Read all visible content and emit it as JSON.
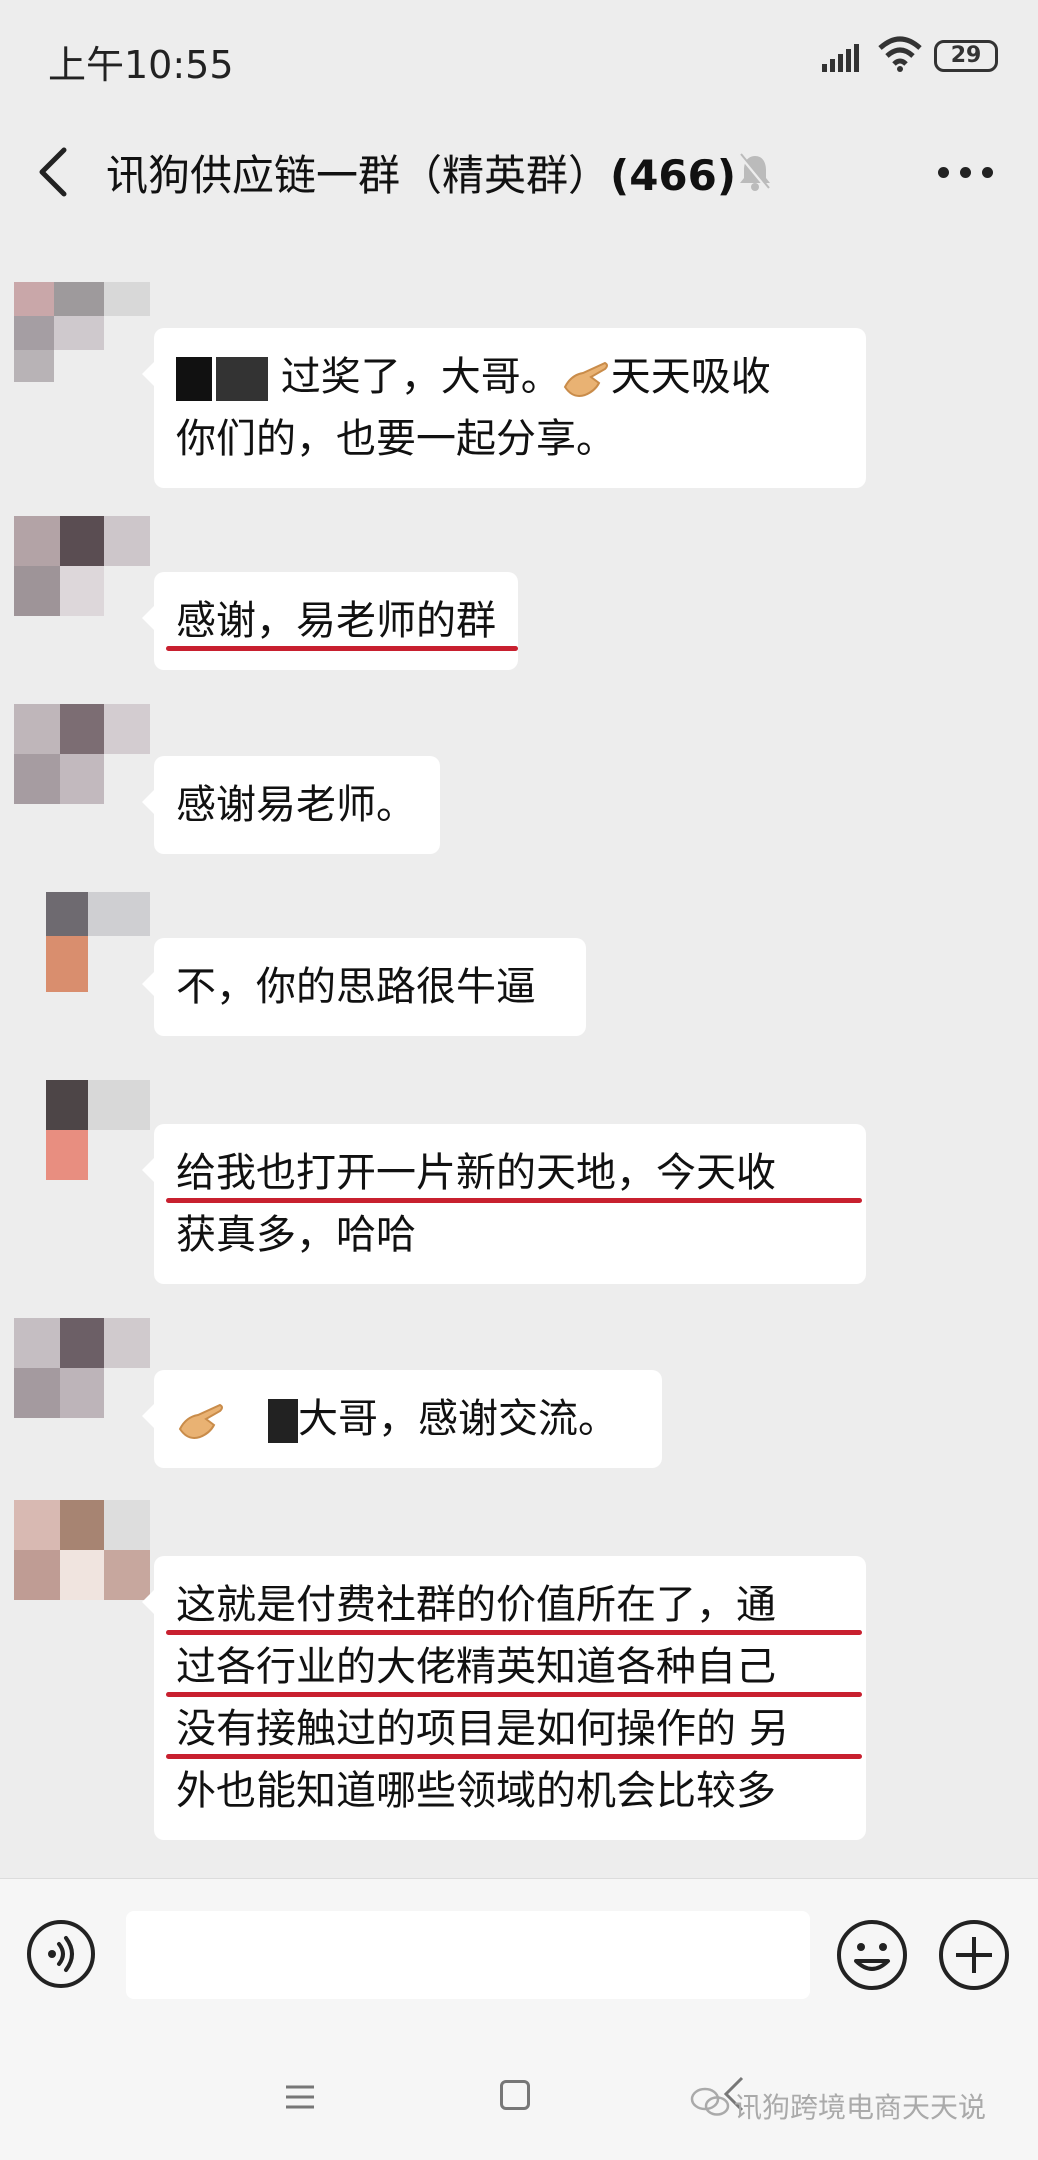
{
  "status_bar": {
    "time": "上午10:55",
    "battery": "29"
  },
  "header": {
    "title": "讯狗供应链一群（精英群）",
    "member_count": "(466)"
  },
  "messages": [
    {
      "lines": [
        "过奖了，大哥。",
        "天天吸收",
        "你们的，也要一起分享。"
      ]
    },
    {
      "lines": [
        "感谢，易老师的群"
      ]
    },
    {
      "lines": [
        "感谢易老师。"
      ]
    },
    {
      "lines": [
        "不，你的思路很牛逼"
      ]
    },
    {
      "lines": [
        "给我也打开一片新的天地，今天收",
        "获真多，哈哈"
      ]
    },
    {
      "lines": [
        "大哥，感谢交流。"
      ]
    },
    {
      "lines": [
        "这就是付费社群的价值所在了，通",
        "过各行业的大佬精英知道各种自己",
        "没有接触过的项目是如何操作的 另",
        "外也能知道哪些领域的机会比较多"
      ]
    }
  ],
  "watermark": "讯狗跨境电商天天说",
  "colors": {
    "underline": "#c8202f",
    "bubble": "#ffffff",
    "background": "#ededed"
  },
  "icons": [
    "signal-icon",
    "wifi-icon",
    "battery-icon",
    "back-icon",
    "mute-bell-icon",
    "more-icon",
    "voice-icon",
    "emoji-icon",
    "plus-icon",
    "nav-menu-icon",
    "nav-home-icon",
    "nav-back-icon",
    "wechat-logo-icon"
  ]
}
